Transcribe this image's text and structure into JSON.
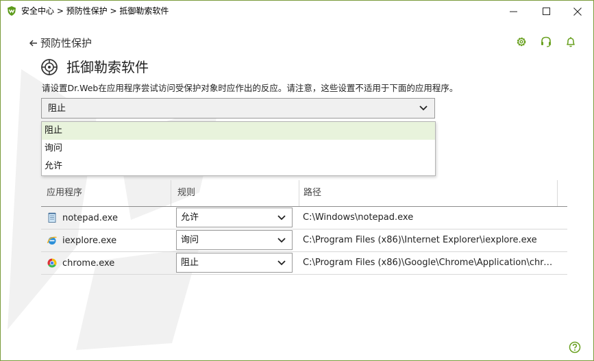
{
  "window": {
    "title": "安全中心 > 预防性保护 > 抵御勒索软件",
    "controls": [
      "minimize-icon",
      "maximize-icon",
      "close-icon"
    ]
  },
  "nav": {
    "back_label": "预防性保护",
    "top_icons": [
      "gear-icon",
      "headset-icon",
      "bell-icon"
    ]
  },
  "page": {
    "title": "抵御勒索软件",
    "description": "请设置Dr.Web在应用程序尝试访问受保护对象时应作出的反应。请注意，这些设置不适用于下面的应用程序。"
  },
  "reaction_select": {
    "value": "阻止",
    "options": [
      "阻止",
      "询问",
      "允许"
    ]
  },
  "table": {
    "headers": {
      "app": "应用程序",
      "rule": "规则",
      "path": "路径"
    },
    "rows": [
      {
        "app": "notepad.exe",
        "icon": "notepad-icon",
        "rule": "允许",
        "path": "C:\\Windows\\notepad.exe"
      },
      {
        "app": "iexplore.exe",
        "icon": "internet-explorer-icon",
        "rule": "询问",
        "path": "C:\\Program Files (x86)\\Internet Explorer\\iexplore.exe"
      },
      {
        "app": "chrome.exe",
        "icon": "chrome-icon",
        "rule": "阻止",
        "path": "C:\\Program Files (x86)\\Google\\Chrome\\Application\\chrom..."
      }
    ]
  },
  "colors": {
    "accent": "#6aa121",
    "selected_option_bg": "#e8f3dc",
    "window_border": "#7a9a3a"
  }
}
